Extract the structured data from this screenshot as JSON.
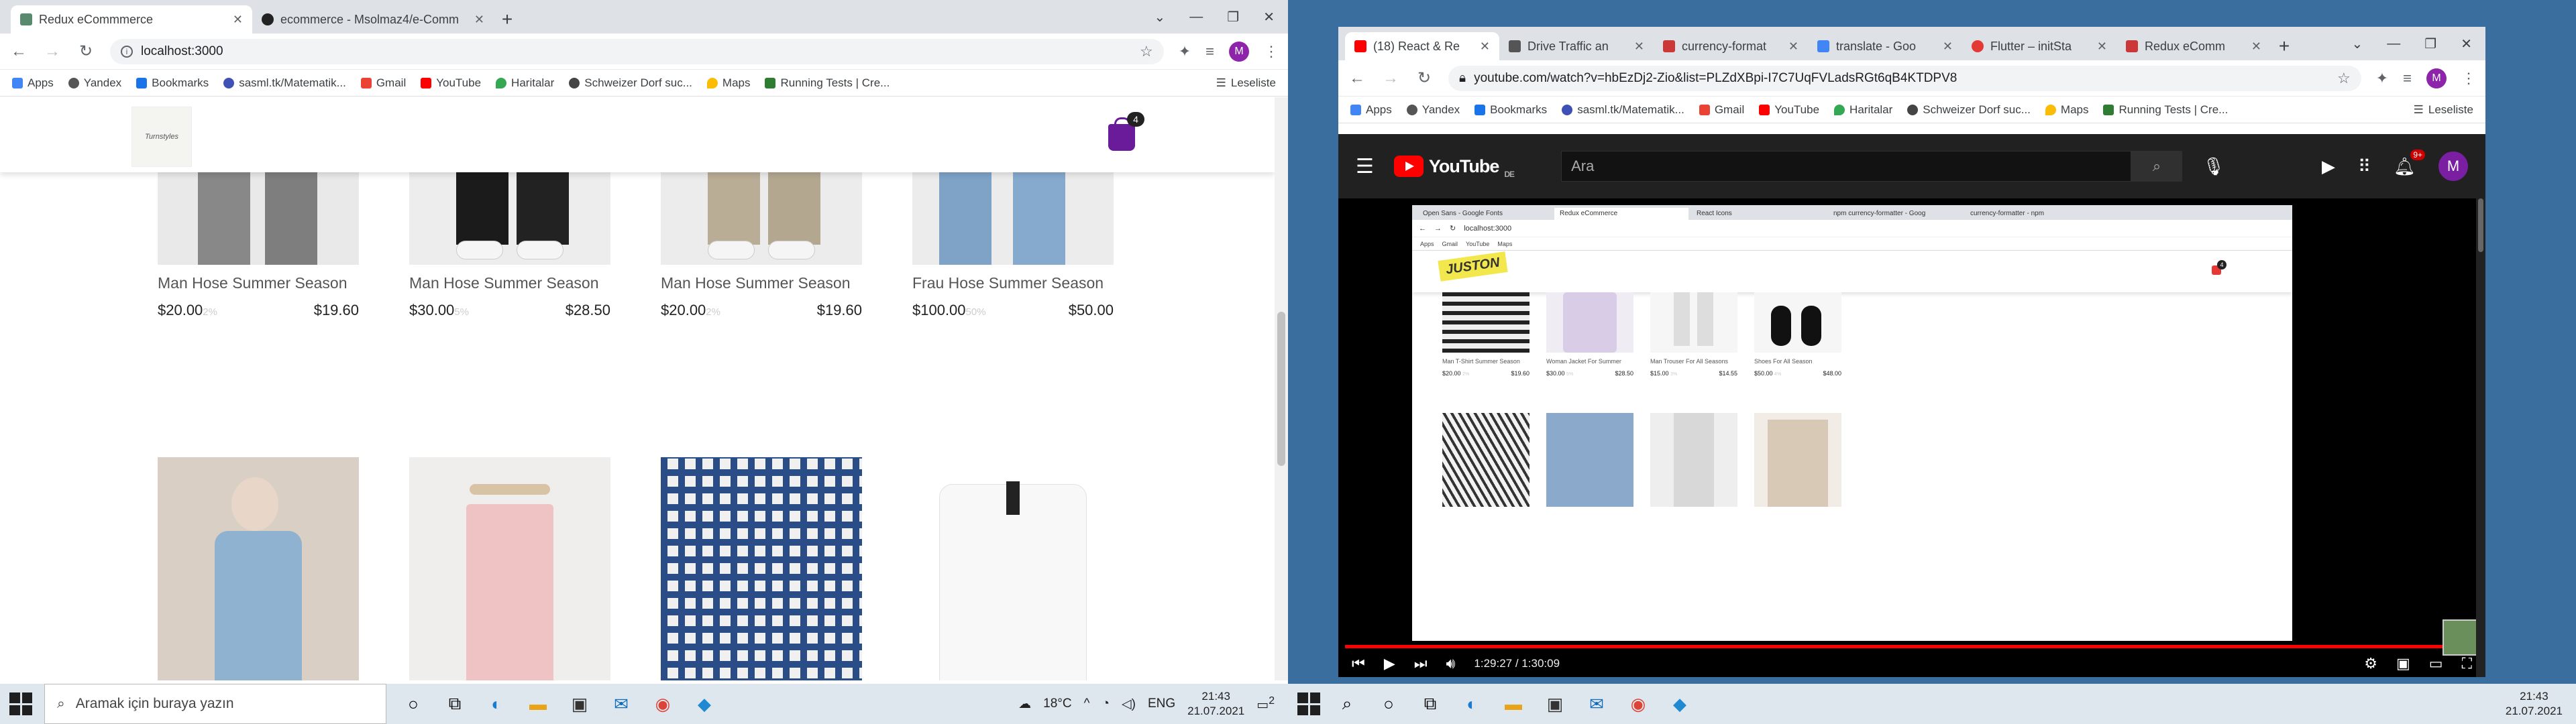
{
  "left": {
    "tabs": [
      {
        "label": "Redux eCommmerce",
        "active": true
      },
      {
        "label": "ecommerce - Msolmaz4/e-Comm",
        "active": false
      }
    ],
    "url": "localhost:3000",
    "avatar_letter": "M",
    "bookmarks": [
      "Apps",
      "Yandex",
      "Bookmarks",
      "sasml.tk/Matematik...",
      "Gmail",
      "YouTube",
      "Haritalar",
      "Schweizer Dorf suc...",
      "Maps",
      "Running Tests | Cre..."
    ],
    "reading_list": "Leseliste",
    "cart_count": "4",
    "logo_text": "Turnstyles",
    "products": [
      {
        "name": "Man Hose Summer Season",
        "price": "$20.00",
        "discount": "2%",
        "final": "$19.60"
      },
      {
        "name": "Man Hose Summer Season",
        "price": "$30.00",
        "discount": "5%",
        "final": "$28.50"
      },
      {
        "name": "Man Hose Summer Season",
        "price": "$20.00",
        "discount": "2%",
        "final": "$19.60"
      },
      {
        "name": "Frau Hose Summer Season",
        "price": "$100.00",
        "discount": "50%",
        "final": "$50.00"
      }
    ]
  },
  "right": {
    "tabs": [
      {
        "label": "(18) React & Re"
      },
      {
        "label": "Drive Traffic an"
      },
      {
        "label": "currency-format"
      },
      {
        "label": "translate - Goo"
      },
      {
        "label": "Flutter – initSta"
      },
      {
        "label": "Redux eComm"
      }
    ],
    "url": "youtube.com/watch?v=hbEzDj2-Zio&list=PLZdXBpi-I7C7UqFVLadsRGt6qB4KTDPV8",
    "avatar_letter": "M",
    "bookmarks": [
      "Apps",
      "Yandex",
      "Bookmarks",
      "sasml.tk/Matematik...",
      "Gmail",
      "YouTube",
      "Haritalar",
      "Schweizer Dorf suc...",
      "Maps",
      "Running Tests | Cre..."
    ],
    "reading_list": "Leseliste",
    "youtube": {
      "logo": "YouTube",
      "region": "DE",
      "search_placeholder": "Ara",
      "notifications": "9+",
      "avatar_letter": "M",
      "time": "1:29:27 / 1:30:09",
      "progress": 0.992
    },
    "inner": {
      "tabs": [
        "Open Sans - Google Fonts",
        "Redux eCommerce",
        "React Icons",
        "npm currency-formatter - Goog",
        "currency-formatter - npm"
      ],
      "url": "localhost:3000",
      "bookmarks": [
        "Apps",
        "Gmail",
        "YouTube",
        "Maps"
      ],
      "logo": "JUSTON",
      "cart_count": "4",
      "products": [
        {
          "name": "Man T-Shirt Summer Season",
          "price": "$20.00",
          "discount": "2%",
          "final": "$19.60"
        },
        {
          "name": "Woman Jacket For Summer",
          "price": "$30.00",
          "discount": "5%",
          "final": "$28.50"
        },
        {
          "name": "Man Trouser For All Seasons",
          "price": "$15.00",
          "discount": "3%",
          "final": "$14.55"
        },
        {
          "name": "Shoes For All Season",
          "price": "$50.00",
          "discount": "4%",
          "final": "$48.00"
        }
      ]
    }
  },
  "taskbar_left": {
    "search_placeholder": "Aramak için buraya yazın",
    "weather": "18°C",
    "lang": "ENG",
    "time": "21:43",
    "date": "21.07.2021",
    "notif": "2"
  },
  "taskbar_right": {
    "time": "21:43",
    "date": "21.07.2021"
  }
}
